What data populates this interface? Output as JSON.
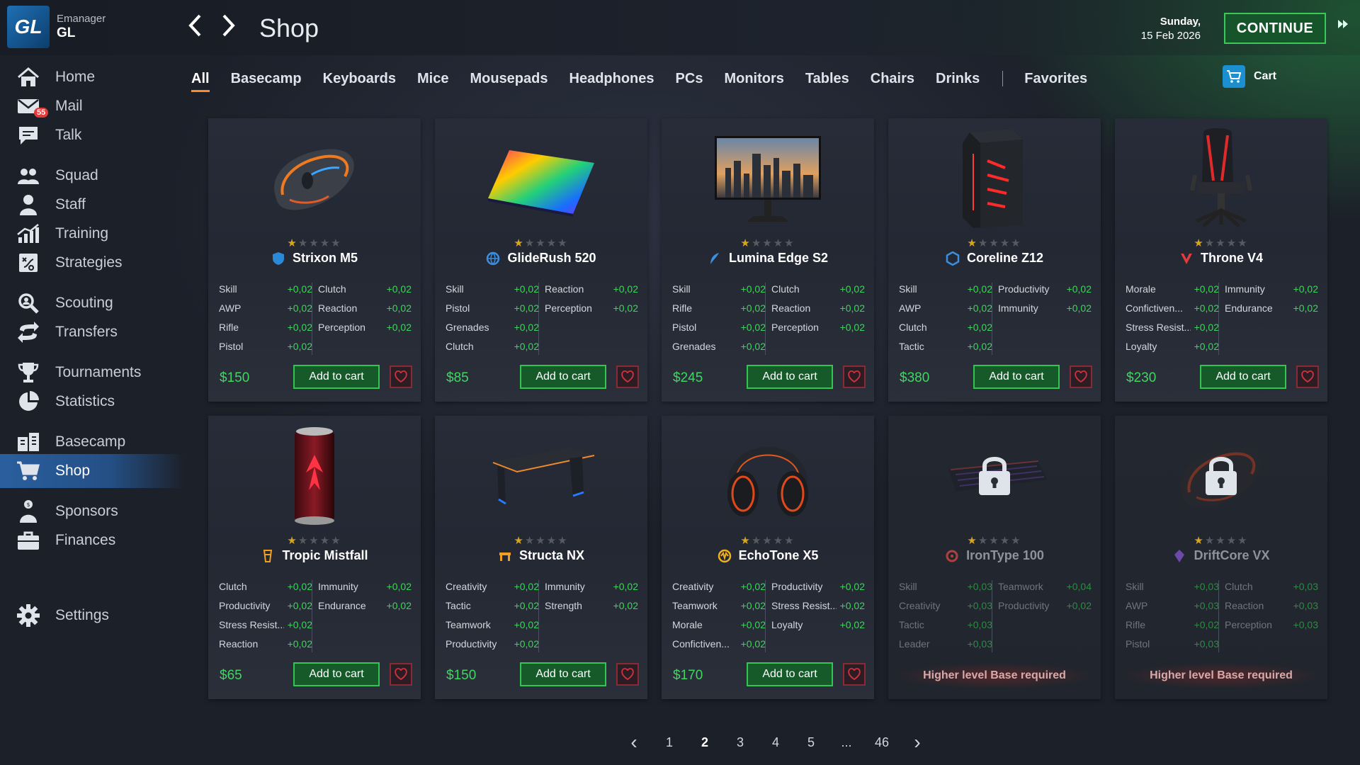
{
  "app": {
    "brand_top": "Emanager",
    "brand_bottom": "GL",
    "logo_text": "GL"
  },
  "header": {
    "title": "Shop",
    "date_day": "Sunday,",
    "date_full": "15 Feb 2026",
    "continue_label": "CONTINUE"
  },
  "sidebar": {
    "items": [
      {
        "label": "Home",
        "icon": "home-icon"
      },
      {
        "label": "Mail",
        "icon": "mail-icon",
        "badge": "55"
      },
      {
        "label": "Talk",
        "icon": "chat-icon"
      },
      {
        "label": "Squad",
        "icon": "squad-icon"
      },
      {
        "label": "Staff",
        "icon": "staff-icon"
      },
      {
        "label": "Training",
        "icon": "training-icon"
      },
      {
        "label": "Strategies",
        "icon": "strategies-icon"
      },
      {
        "label": "Scouting",
        "icon": "scouting-icon"
      },
      {
        "label": "Transfers",
        "icon": "transfers-icon"
      },
      {
        "label": "Tournaments",
        "icon": "trophy-icon"
      },
      {
        "label": "Statistics",
        "icon": "statistics-icon"
      },
      {
        "label": "Basecamp",
        "icon": "basecamp-icon"
      },
      {
        "label": "Shop",
        "icon": "cart-icon",
        "active": true
      },
      {
        "label": "Sponsors",
        "icon": "sponsors-icon"
      },
      {
        "label": "Finances",
        "icon": "briefcase-icon"
      },
      {
        "label": "Settings",
        "icon": "gear-icon"
      }
    ]
  },
  "tabs": [
    "All",
    "Basecamp",
    "Keyboards",
    "Mice",
    "Mousepads",
    "Headphones",
    "PCs",
    "Monitors",
    "Tables",
    "Chairs",
    "Drinks"
  ],
  "favorites_tab": "Favorites",
  "cart_label": "Cart",
  "add_label": "Add to cart",
  "products": [
    {
      "name": "Strixon M5",
      "price": "$150",
      "rating": 1,
      "brand_icon": "brand-shield-icon",
      "image": "mouse",
      "stats_left": [
        [
          "Skill",
          "+0,02"
        ],
        [
          "AWP",
          "+0,02"
        ],
        [
          "Rifle",
          "+0,02"
        ],
        [
          "Pistol",
          "+0,02"
        ]
      ],
      "stats_right": [
        [
          "Clutch",
          "+0,02"
        ],
        [
          "Reaction",
          "+0,02"
        ],
        [
          "Perception",
          "+0,02"
        ]
      ]
    },
    {
      "name": "GlideRush 520",
      "price": "$85",
      "rating": 1,
      "brand_icon": "brand-globe-icon",
      "image": "mousepad",
      "stats_left": [
        [
          "Skill",
          "+0,02"
        ],
        [
          "Pistol",
          "+0,02"
        ],
        [
          "Grenades",
          "+0,02"
        ],
        [
          "Clutch",
          "+0,02"
        ]
      ],
      "stats_right": [
        [
          "Reaction",
          "+0,02"
        ],
        [
          "Perception",
          "+0,02"
        ]
      ]
    },
    {
      "name": "Lumina Edge S2",
      "price": "$245",
      "rating": 1,
      "brand_icon": "brand-feather-icon",
      "image": "monitor",
      "stats_left": [
        [
          "Skill",
          "+0,02"
        ],
        [
          "Rifle",
          "+0,02"
        ],
        [
          "Pistol",
          "+0,02"
        ],
        [
          "Grenades",
          "+0,02"
        ]
      ],
      "stats_right": [
        [
          "Clutch",
          "+0,02"
        ],
        [
          "Reaction",
          "+0,02"
        ],
        [
          "Perception",
          "+0,02"
        ]
      ]
    },
    {
      "name": "Coreline Z12",
      "price": "$380",
      "rating": 1,
      "brand_icon": "brand-hex-icon",
      "image": "pc",
      "stats_left": [
        [
          "Skill",
          "+0,02"
        ],
        [
          "AWP",
          "+0,02"
        ],
        [
          "Clutch",
          "+0,02"
        ],
        [
          "Tactic",
          "+0,02"
        ]
      ],
      "stats_right": [
        [
          "Productivity",
          "+0,02"
        ],
        [
          "Immunity",
          "+0,02"
        ]
      ]
    },
    {
      "name": "Throne V4",
      "price": "$230",
      "rating": 1,
      "brand_icon": "brand-v-icon",
      "image": "chair",
      "stats_left": [
        [
          "Morale",
          "+0,02"
        ],
        [
          "Confictiven...",
          "+0,02"
        ],
        [
          "Stress Resist...",
          "+0,02"
        ],
        [
          "Loyalty",
          "+0,02"
        ]
      ],
      "stats_right": [
        [
          "Immunity",
          "+0,02"
        ],
        [
          "Endurance",
          "+0,02"
        ]
      ]
    },
    {
      "name": "Tropic Mistfall",
      "price": "$65",
      "rating": 1,
      "brand_icon": "brand-drink-icon",
      "image": "can",
      "stats_left": [
        [
          "Clutch",
          "+0,02"
        ],
        [
          "Productivity",
          "+0,02"
        ],
        [
          "Stress Resist...",
          "+0,02"
        ],
        [
          "Reaction",
          "+0,02"
        ]
      ],
      "stats_right": [
        [
          "Immunity",
          "+0,02"
        ],
        [
          "Endurance",
          "+0,02"
        ]
      ]
    },
    {
      "name": "Structa NX",
      "price": "$150",
      "rating": 1,
      "brand_icon": "brand-desk-icon",
      "image": "desk",
      "stats_left": [
        [
          "Creativity",
          "+0,02"
        ],
        [
          "Tactic",
          "+0,02"
        ],
        [
          "Teamwork",
          "+0,02"
        ],
        [
          "Productivity",
          "+0,02"
        ]
      ],
      "stats_right": [
        [
          "Immunity",
          "+0,02"
        ],
        [
          "Strength",
          "+0,02"
        ]
      ]
    },
    {
      "name": "EchoTone X5",
      "price": "$170",
      "rating": 1,
      "brand_icon": "brand-wave-icon",
      "image": "headphones",
      "stats_left": [
        [
          "Creativity",
          "+0,02"
        ],
        [
          "Teamwork",
          "+0,02"
        ],
        [
          "Morale",
          "+0,02"
        ],
        [
          "Confictiven...",
          "+0,02"
        ]
      ],
      "stats_right": [
        [
          "Productivity",
          "+0,02"
        ],
        [
          "Stress Resist...",
          "+0,02"
        ],
        [
          "Loyalty",
          "+0,02"
        ]
      ]
    },
    {
      "name": "IronType 100",
      "locked": true,
      "locked_msg": "Higher level Base required",
      "rating": 1,
      "brand_icon": "brand-gear-icon",
      "image": "keyboard",
      "stats_left": [
        [
          "Skill",
          "+0,03"
        ],
        [
          "Creativity",
          "+0,03"
        ],
        [
          "Tactic",
          "+0,03"
        ],
        [
          "Leader",
          "+0,03"
        ]
      ],
      "stats_right": [
        [
          "Teamwork",
          "+0,04"
        ],
        [
          "Productivity",
          "+0,02"
        ]
      ]
    },
    {
      "name": "DriftCore VX",
      "locked": true,
      "locked_msg": "Higher level Base required",
      "rating": 1,
      "brand_icon": "brand-crystal-icon",
      "image": "mouse2",
      "stats_left": [
        [
          "Skill",
          "+0,03"
        ],
        [
          "AWP",
          "+0,03"
        ],
        [
          "Rifle",
          "+0,02"
        ],
        [
          "Pistol",
          "+0,03"
        ]
      ],
      "stats_right": [
        [
          "Clutch",
          "+0,03"
        ],
        [
          "Reaction",
          "+0,03"
        ],
        [
          "Perception",
          "+0,03"
        ]
      ]
    }
  ],
  "pager": {
    "prev": "‹",
    "next": "›",
    "pages": [
      "1",
      "2",
      "3",
      "4",
      "5",
      "...",
      "46"
    ],
    "current": "2"
  },
  "colors": {
    "accent_green": "#3ad65b",
    "active_tab_underline": "#ff8a2a",
    "sidebar_active": "#2a5f9e",
    "lock_msg": "#d9a9a9"
  }
}
